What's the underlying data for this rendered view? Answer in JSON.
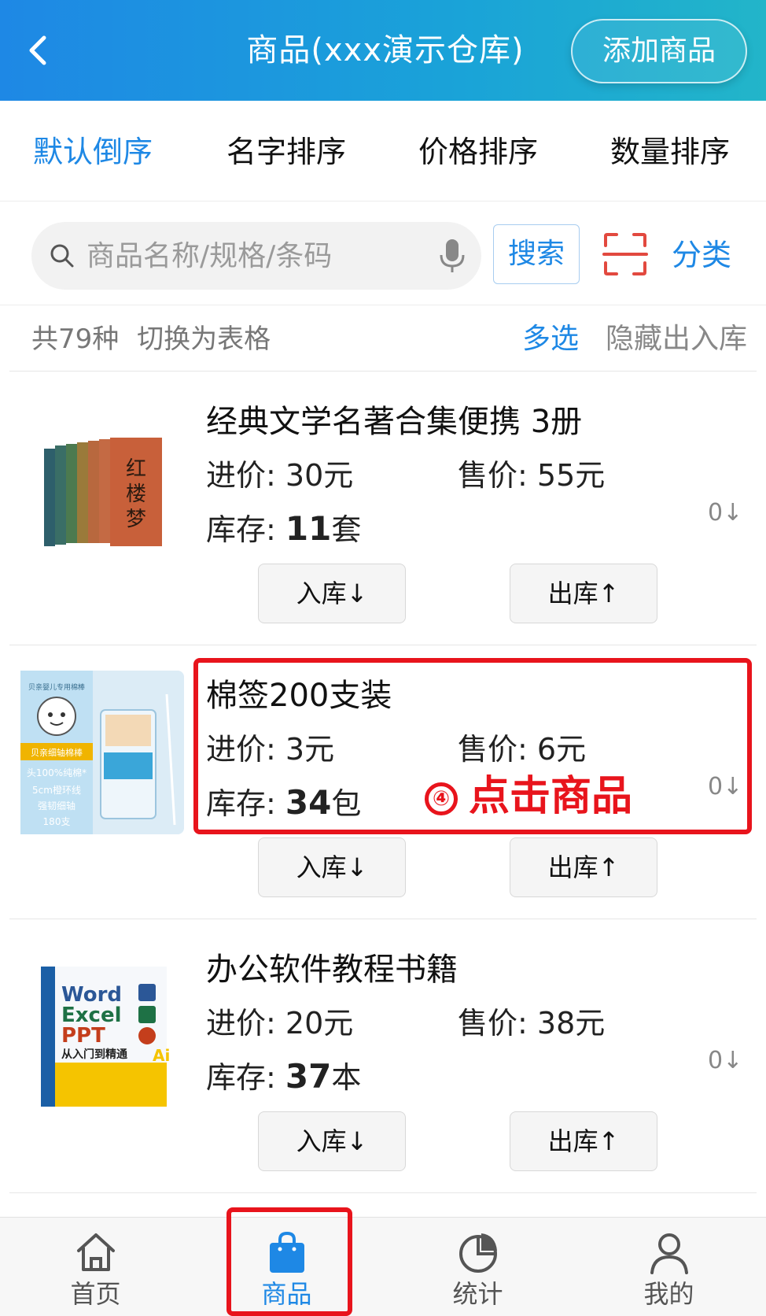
{
  "header": {
    "title": "商品(xxx演示仓库)",
    "add_button": "添加商品"
  },
  "sort_tabs": [
    {
      "label": "默认倒序",
      "active": true
    },
    {
      "label": "名字排序",
      "active": false
    },
    {
      "label": "价格排序",
      "active": false
    },
    {
      "label": "数量排序",
      "active": false
    }
  ],
  "search": {
    "placeholder": "商品名称/规格/条码",
    "button": "搜索",
    "category": "分类"
  },
  "info_bar": {
    "count": "共79种",
    "toggle": "切换为表格",
    "multi_select": "多选",
    "hide_io": "隐藏出入库"
  },
  "products": [
    {
      "name": "经典文学名著合集便携  3册",
      "buy_label": "进价:",
      "buy_price": "30元",
      "sell_label": "售价:",
      "sell_price": "55元",
      "stock_label": "库存:",
      "stock_num": "11",
      "stock_unit": "套",
      "side": "0↓",
      "in_button": "入库↓",
      "out_button": "出库↑",
      "thumb": "book-set-thumbnail",
      "thumb_title": "红楼梦"
    },
    {
      "name": "棉签200支装",
      "buy_label": "进价:",
      "buy_price": "3元",
      "sell_label": "售价:",
      "sell_price": "6元",
      "stock_label": "库存:",
      "stock_num": "34",
      "stock_unit": "包",
      "side": "0↓",
      "in_button": "入库↓",
      "out_button": "出库↑",
      "thumb": "cotton-swab-thumbnail",
      "thumb_lines": [
        "贝亲婴儿专用棉棒",
        "贝亲细轴棉棒",
        "头100%纯棉*",
        "5cm橙环线",
        "强韧细轴",
        "180支"
      ]
    },
    {
      "name": "办公软件教程书籍",
      "buy_label": "进价:",
      "buy_price": "20元",
      "sell_label": "售价:",
      "sell_price": "38元",
      "stock_label": "库存:",
      "stock_num": "37",
      "stock_unit": "本",
      "side": "0↓",
      "in_button": "入库↓",
      "out_button": "出库↑",
      "thumb": "office-book-thumbnail",
      "thumb_lines": [
        "Word",
        "Excel",
        "PPT",
        "从入门到精通",
        "Ai"
      ]
    }
  ],
  "annotation": {
    "step": "④",
    "text": "点击商品"
  },
  "bottom_nav": [
    {
      "label": "首页",
      "icon": "home-icon",
      "active": false
    },
    {
      "label": "商品",
      "icon": "shopping-bag-icon",
      "active": true
    },
    {
      "label": "统计",
      "icon": "pie-chart-icon",
      "active": false
    },
    {
      "label": "我的",
      "icon": "user-icon",
      "active": false
    }
  ],
  "colors": {
    "accent": "#1e88e5",
    "annotation_red": "#e8141c"
  }
}
